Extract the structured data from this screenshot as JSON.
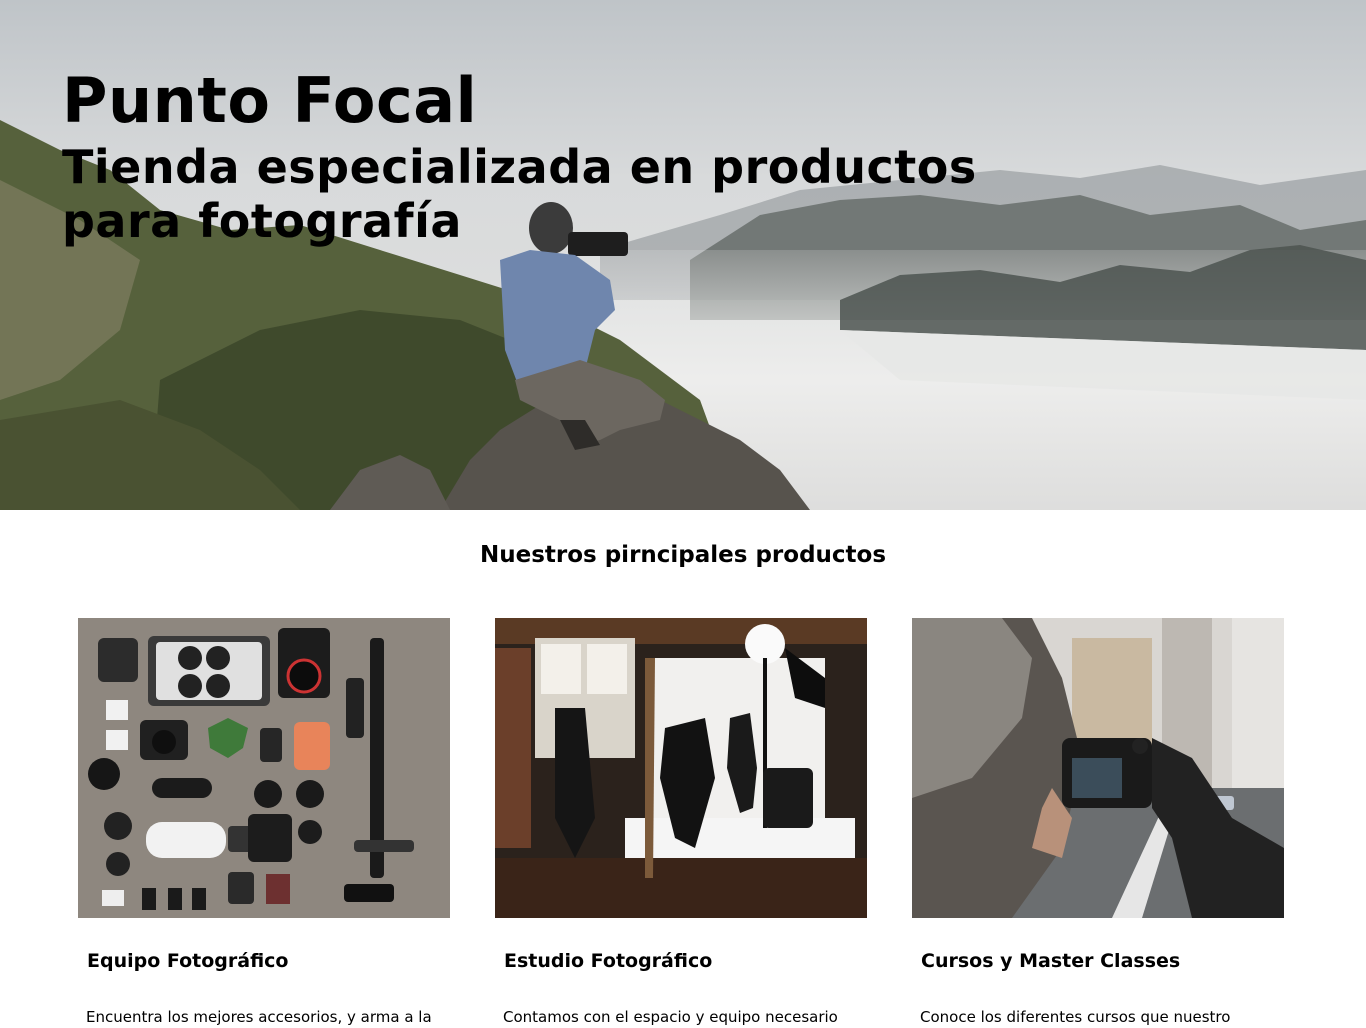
{
  "hero": {
    "title": "Punto Focal",
    "subtitle": "Tienda especializada en productos para fotografía",
    "image": "photographer-on-mountain-photo"
  },
  "products_section": {
    "title": "Nuestros pirncipales productos",
    "items": [
      {
        "title": "Equipo Fotográfico",
        "text": "Encuentra los mejores accesorios, y arma a la",
        "image": "camera-gear-flatlay-photo"
      },
      {
        "title": "Estudio Fotográfico",
        "text": "Contamos con el espacio y equipo necesario",
        "image": "photo-studio-photo"
      },
      {
        "title": "Cursos y Master Classes",
        "text": "Conoce los diferentes cursos que nuestro",
        "image": "street-photographer-photo"
      }
    ]
  }
}
